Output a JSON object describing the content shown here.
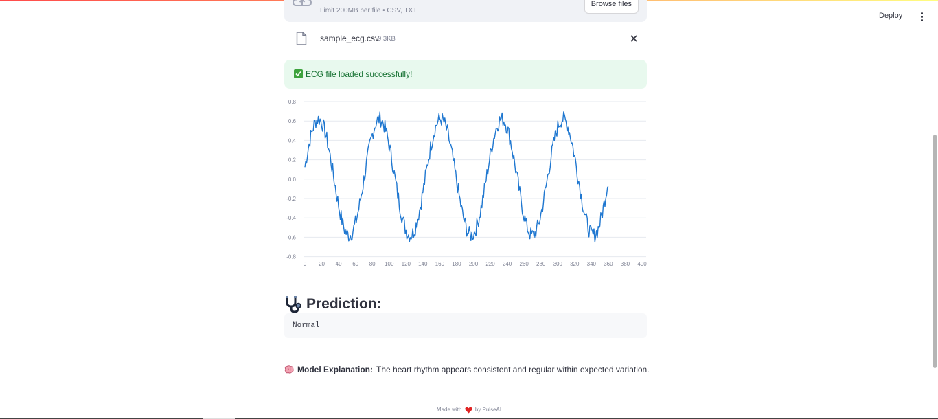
{
  "header": {
    "deploy_label": "Deploy",
    "menu_icon": "kebab-menu-icon"
  },
  "uploader": {
    "icon": "cloud-upload-icon",
    "limit_text": "Limit 200MB per file • CSV, TXT",
    "browse_label": "Browse files",
    "file": {
      "icon": "file-icon",
      "name": "sample_ecg.csv",
      "size": "9.3KB",
      "remove_icon": "close-icon"
    }
  },
  "alert": {
    "icon": "check-mark-icon",
    "text": "ECG file loaded successfully!",
    "background": "#e8f9ee",
    "color": "#177233"
  },
  "chart_data": {
    "type": "line",
    "series_color": "#1f77d0",
    "xlim": [
      0,
      400
    ],
    "ylim": [
      -0.85,
      0.85
    ],
    "x_ticks": [
      "0",
      "20",
      "40",
      "60",
      "80",
      "100",
      "120",
      "140",
      "160",
      "180",
      "200",
      "220",
      "240",
      "260",
      "280",
      "300",
      "320",
      "340",
      "360",
      "380",
      "400"
    ],
    "y_ticks": [
      "0.8",
      "0.6",
      "0.4",
      "0.2",
      "0.0",
      "-0.2",
      "-0.4",
      "-0.6",
      "-0.8"
    ],
    "sampling": {
      "n": 360,
      "period": 72.5,
      "amplitude": 0.6,
      "noise": 0.08
    },
    "grid": true,
    "legend": "none"
  },
  "prediction": {
    "icon": "stethoscope-icon",
    "title": "Prediction:",
    "value": "Normal"
  },
  "explanation": {
    "icon": "brain-icon",
    "label": "Model Explanation:",
    "text": "The heart rhythm appears consistent and regular within expected variation."
  },
  "footer": {
    "prefix": "Made with",
    "icon": "heart-icon",
    "suffix": "by PulseAI"
  }
}
